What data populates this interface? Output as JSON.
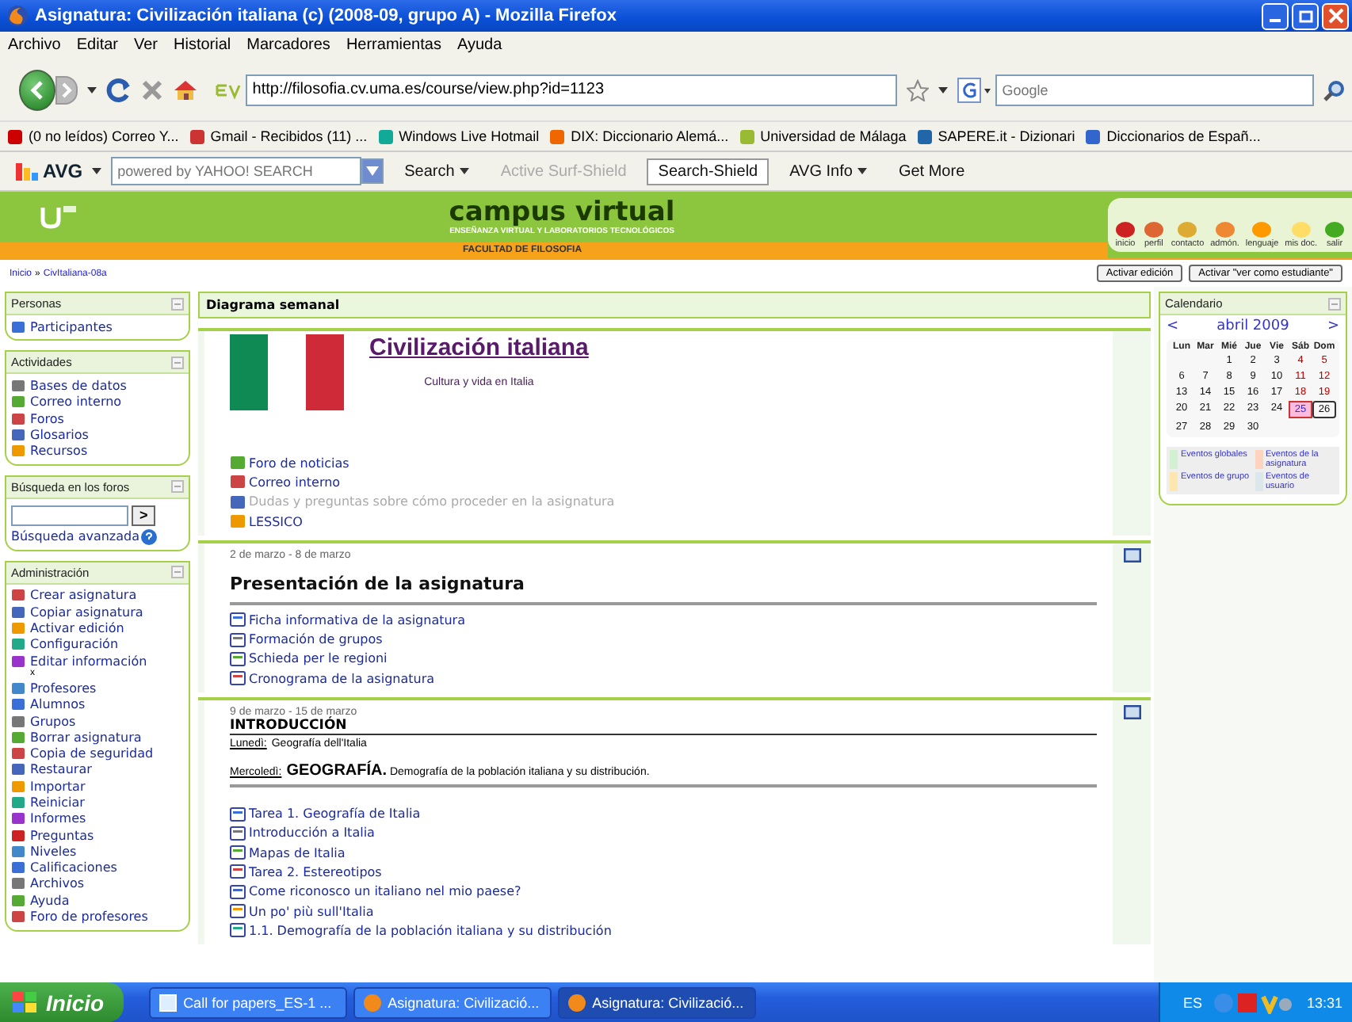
{
  "window": {
    "title": "Asignatura: Civilización italiana (c) (2008-09, grupo A) - Mozilla Firefox"
  },
  "menu": [
    "Archivo",
    "Editar",
    "Ver",
    "Historial",
    "Marcadores",
    "Herramientas",
    "Ayuda"
  ],
  "navigation": {
    "url": "http://filosofia.cv.uma.es/course/view.php?id=1123",
    "search_placeholder": "Google"
  },
  "bookmarks": [
    "(0 no leídos) Correo Y...",
    "Gmail - Recibidos (11) ...",
    "Windows Live Hotmail",
    "DIX: Diccionario Alemá...",
    "Universidad de Málaga",
    "SAPERE.it - Dizionari",
    "Diccionarios de Españ..."
  ],
  "avg_toolbar": {
    "logo": "AVG",
    "search_placeholder": "powered by YAHOO! SEARCH",
    "buttons": [
      {
        "label": "Search",
        "disabled": false,
        "selected": false,
        "dropdown": true
      },
      {
        "label": "Active Surf-Shield",
        "disabled": true,
        "selected": false,
        "dropdown": false
      },
      {
        "label": "Search-Shield",
        "disabled": false,
        "selected": true,
        "dropdown": false
      },
      {
        "label": "AVG Info",
        "disabled": false,
        "selected": false,
        "dropdown": true
      },
      {
        "label": "Get More",
        "disabled": false,
        "selected": false,
        "dropdown": false
      }
    ]
  },
  "site_header": {
    "title": "campus virtual",
    "subtitle": "ENSEÑANZA VIRTUAL Y LABORATORIOS TECNOLÓGICOS",
    "faculty": "FACULTAD DE FILOSOFIA",
    "shortcuts": [
      "inicio",
      "perfil",
      "contacto",
      "admón.",
      "lenguaje",
      "mis doc.",
      "salir"
    ]
  },
  "breadcrumb": [
    "Inicio",
    "»",
    "CivItaliana-08a"
  ],
  "page_buttons": [
    "Activar edición",
    "Activar \"ver como estudiante\""
  ],
  "sidebar": [
    {
      "title": "Personas",
      "items": [
        {
          "kind": "link",
          "label": "Participantes"
        }
      ]
    },
    {
      "title": "Actividades",
      "items": [
        {
          "kind": "link",
          "label": "Bases de datos"
        },
        {
          "kind": "link",
          "label": "Correo interno"
        },
        {
          "kind": "link",
          "label": "Foros"
        },
        {
          "kind": "link",
          "label": "Glosarios"
        },
        {
          "kind": "link",
          "label": "Recursos"
        }
      ]
    },
    {
      "title": "Búsqueda en los foros",
      "search": {
        "button": ">",
        "advanced": "Búsqueda avanzada"
      }
    },
    {
      "title": "Administración",
      "items": [
        {
          "kind": "link",
          "label": "Crear asignatura"
        },
        {
          "kind": "link",
          "label": "Copiar asignatura"
        },
        {
          "kind": "link",
          "label": "Activar edición"
        },
        {
          "kind": "link",
          "label": "Configuración"
        },
        {
          "kind": "link",
          "label": "Editar información"
        },
        {
          "kind": "note",
          "label": "x"
        },
        {
          "kind": "link",
          "label": "Profesores"
        },
        {
          "kind": "link",
          "label": "Alumnos"
        },
        {
          "kind": "link",
          "label": "Grupos"
        },
        {
          "kind": "link",
          "label": "Borrar asignatura"
        },
        {
          "kind": "link",
          "label": "Copia de seguridad"
        },
        {
          "kind": "link",
          "label": "Restaurar"
        },
        {
          "kind": "link",
          "label": "Importar"
        },
        {
          "kind": "link",
          "label": "Reiniciar"
        },
        {
          "kind": "link",
          "label": "Informes"
        },
        {
          "kind": "link",
          "label": "Preguntas"
        },
        {
          "kind": "link",
          "label": "Niveles"
        },
        {
          "kind": "link",
          "label": "Calificaciones"
        },
        {
          "kind": "link",
          "label": "Archivos"
        },
        {
          "kind": "link",
          "label": "Ayuda"
        },
        {
          "kind": "link",
          "label": "Foro de profesores"
        }
      ]
    }
  ],
  "main": {
    "title": "Diagrama semanal",
    "course": {
      "title": "Civilización italiana",
      "subtitle": "Cultura y vida en Italia",
      "links": [
        {
          "label": "Foro de noticias",
          "dimmed": false
        },
        {
          "label": "Correo interno",
          "dimmed": false
        },
        {
          "label": "Dudas y preguntas sobre cómo proceder en la asignatura",
          "dimmed": true
        },
        {
          "label": "LESSICO",
          "dimmed": false
        }
      ]
    },
    "weeks": [
      {
        "dates": "2 de marzo - 8 de marzo",
        "heading": "Presentación de la asignatura",
        "kind": "title",
        "links": [
          "Ficha informativa de la asignatura",
          "Formación de grupos",
          "Schieda per le regioni",
          "Cronograma de la asignatura"
        ]
      },
      {
        "dates": "9 de marzo - 15 de marzo",
        "heading": "INTRODUCCIÓN",
        "kind": "caps",
        "lines": [
          {
            "day": "Lunedì:",
            "text": "Geografía dell'Italia"
          },
          {
            "day": "Mercoledì:",
            "text": "**GEOGRAFÍA.** Demografía de la población italiana y su distribución."
          }
        ],
        "links": [
          "Tarea 1. Geografía de Italia",
          "Introducción a Italia",
          "Mapas de Italia",
          "Tarea 2. Estereotipos",
          "Come riconosco un italiano nel mio paese?",
          "Un po' più sull'Italia",
          "1.1. Demografía de la población italiana y su distribución"
        ]
      }
    ]
  },
  "calendar": {
    "title": "Calendario",
    "prev": "<",
    "month": "abril 2009",
    "next": ">",
    "weekdays": [
      "Lun",
      "Mar",
      "Mié",
      "Jue",
      "Vie",
      "Sáb",
      "Dom"
    ],
    "weeks": [
      {
        "starts_midweek": true,
        "days": [
          {
            "day": "1",
            "weekend": false,
            "today": false,
            "marked": false
          },
          {
            "day": "2",
            "weekend": false,
            "today": false,
            "marked": false
          },
          {
            "day": "3",
            "weekend": false,
            "today": false,
            "marked": false
          },
          {
            "day": "4",
            "weekend": true,
            "today": false,
            "marked": false
          },
          {
            "day": "5",
            "weekend": true,
            "today": false,
            "marked": false
          }
        ]
      },
      {
        "starts_midweek": false,
        "days": [
          {
            "day": "6",
            "weekend": false,
            "today": false,
            "marked": false
          },
          {
            "day": "7",
            "weekend": false,
            "today": false,
            "marked": false
          },
          {
            "day": "8",
            "weekend": false,
            "today": false,
            "marked": false
          },
          {
            "day": "9",
            "weekend": false,
            "today": false,
            "marked": false
          },
          {
            "day": "10",
            "weekend": false,
            "today": false,
            "marked": false
          },
          {
            "day": "11",
            "weekend": true,
            "today": false,
            "marked": false
          },
          {
            "day": "12",
            "weekend": true,
            "today": false,
            "marked": false
          }
        ]
      },
      {
        "starts_midweek": false,
        "days": [
          {
            "day": "13",
            "weekend": false,
            "today": false,
            "marked": false
          },
          {
            "day": "14",
            "weekend": false,
            "today": false,
            "marked": false
          },
          {
            "day": "15",
            "weekend": false,
            "today": false,
            "marked": false
          },
          {
            "day": "16",
            "weekend": false,
            "today": false,
            "marked": false
          },
          {
            "day": "17",
            "weekend": false,
            "today": false,
            "marked": false
          },
          {
            "day": "18",
            "weekend": true,
            "today": false,
            "marked": false
          },
          {
            "day": "19",
            "weekend": true,
            "today": false,
            "marked": false
          }
        ]
      },
      {
        "starts_midweek": false,
        "days": [
          {
            "day": "20",
            "weekend": false,
            "today": false,
            "marked": false
          },
          {
            "day": "21",
            "weekend": false,
            "today": false,
            "marked": false
          },
          {
            "day": "22",
            "weekend": false,
            "today": false,
            "marked": false
          },
          {
            "day": "23",
            "weekend": false,
            "today": false,
            "marked": false
          },
          {
            "day": "24",
            "weekend": false,
            "today": false,
            "marked": false
          },
          {
            "day": "25",
            "weekend": true,
            "today": true,
            "marked": false
          },
          {
            "day": "26",
            "weekend": true,
            "today": false,
            "marked": true
          }
        ]
      },
      {
        "starts_midweek": false,
        "days": [
          {
            "day": "27",
            "weekend": false,
            "today": false,
            "marked": false
          },
          {
            "day": "28",
            "weekend": false,
            "today": false,
            "marked": false
          },
          {
            "day": "29",
            "weekend": false,
            "today": false,
            "marked": false
          },
          {
            "day": "30",
            "weekend": false,
            "today": false,
            "marked": false
          }
        ]
      }
    ],
    "legend": [
      {
        "label": "Eventos globales",
        "color": "#d3f0d3"
      },
      {
        "label": "Eventos de la asignatura",
        "color": "#ffd3bd"
      },
      {
        "label": "Eventos de grupo",
        "color": "#fee7ae"
      },
      {
        "label": "Eventos de usuario",
        "color": "#dce7ec"
      }
    ]
  },
  "taskbar": {
    "start": "Inicio",
    "tasks": [
      {
        "label": "Call for papers_ES-1 ...",
        "selected": false
      },
      {
        "label": "Asignatura: Civilizació...",
        "selected": false
      },
      {
        "label": "Asignatura: Civilizació...",
        "selected": true
      }
    ],
    "language": "ES",
    "time": "13:31"
  }
}
